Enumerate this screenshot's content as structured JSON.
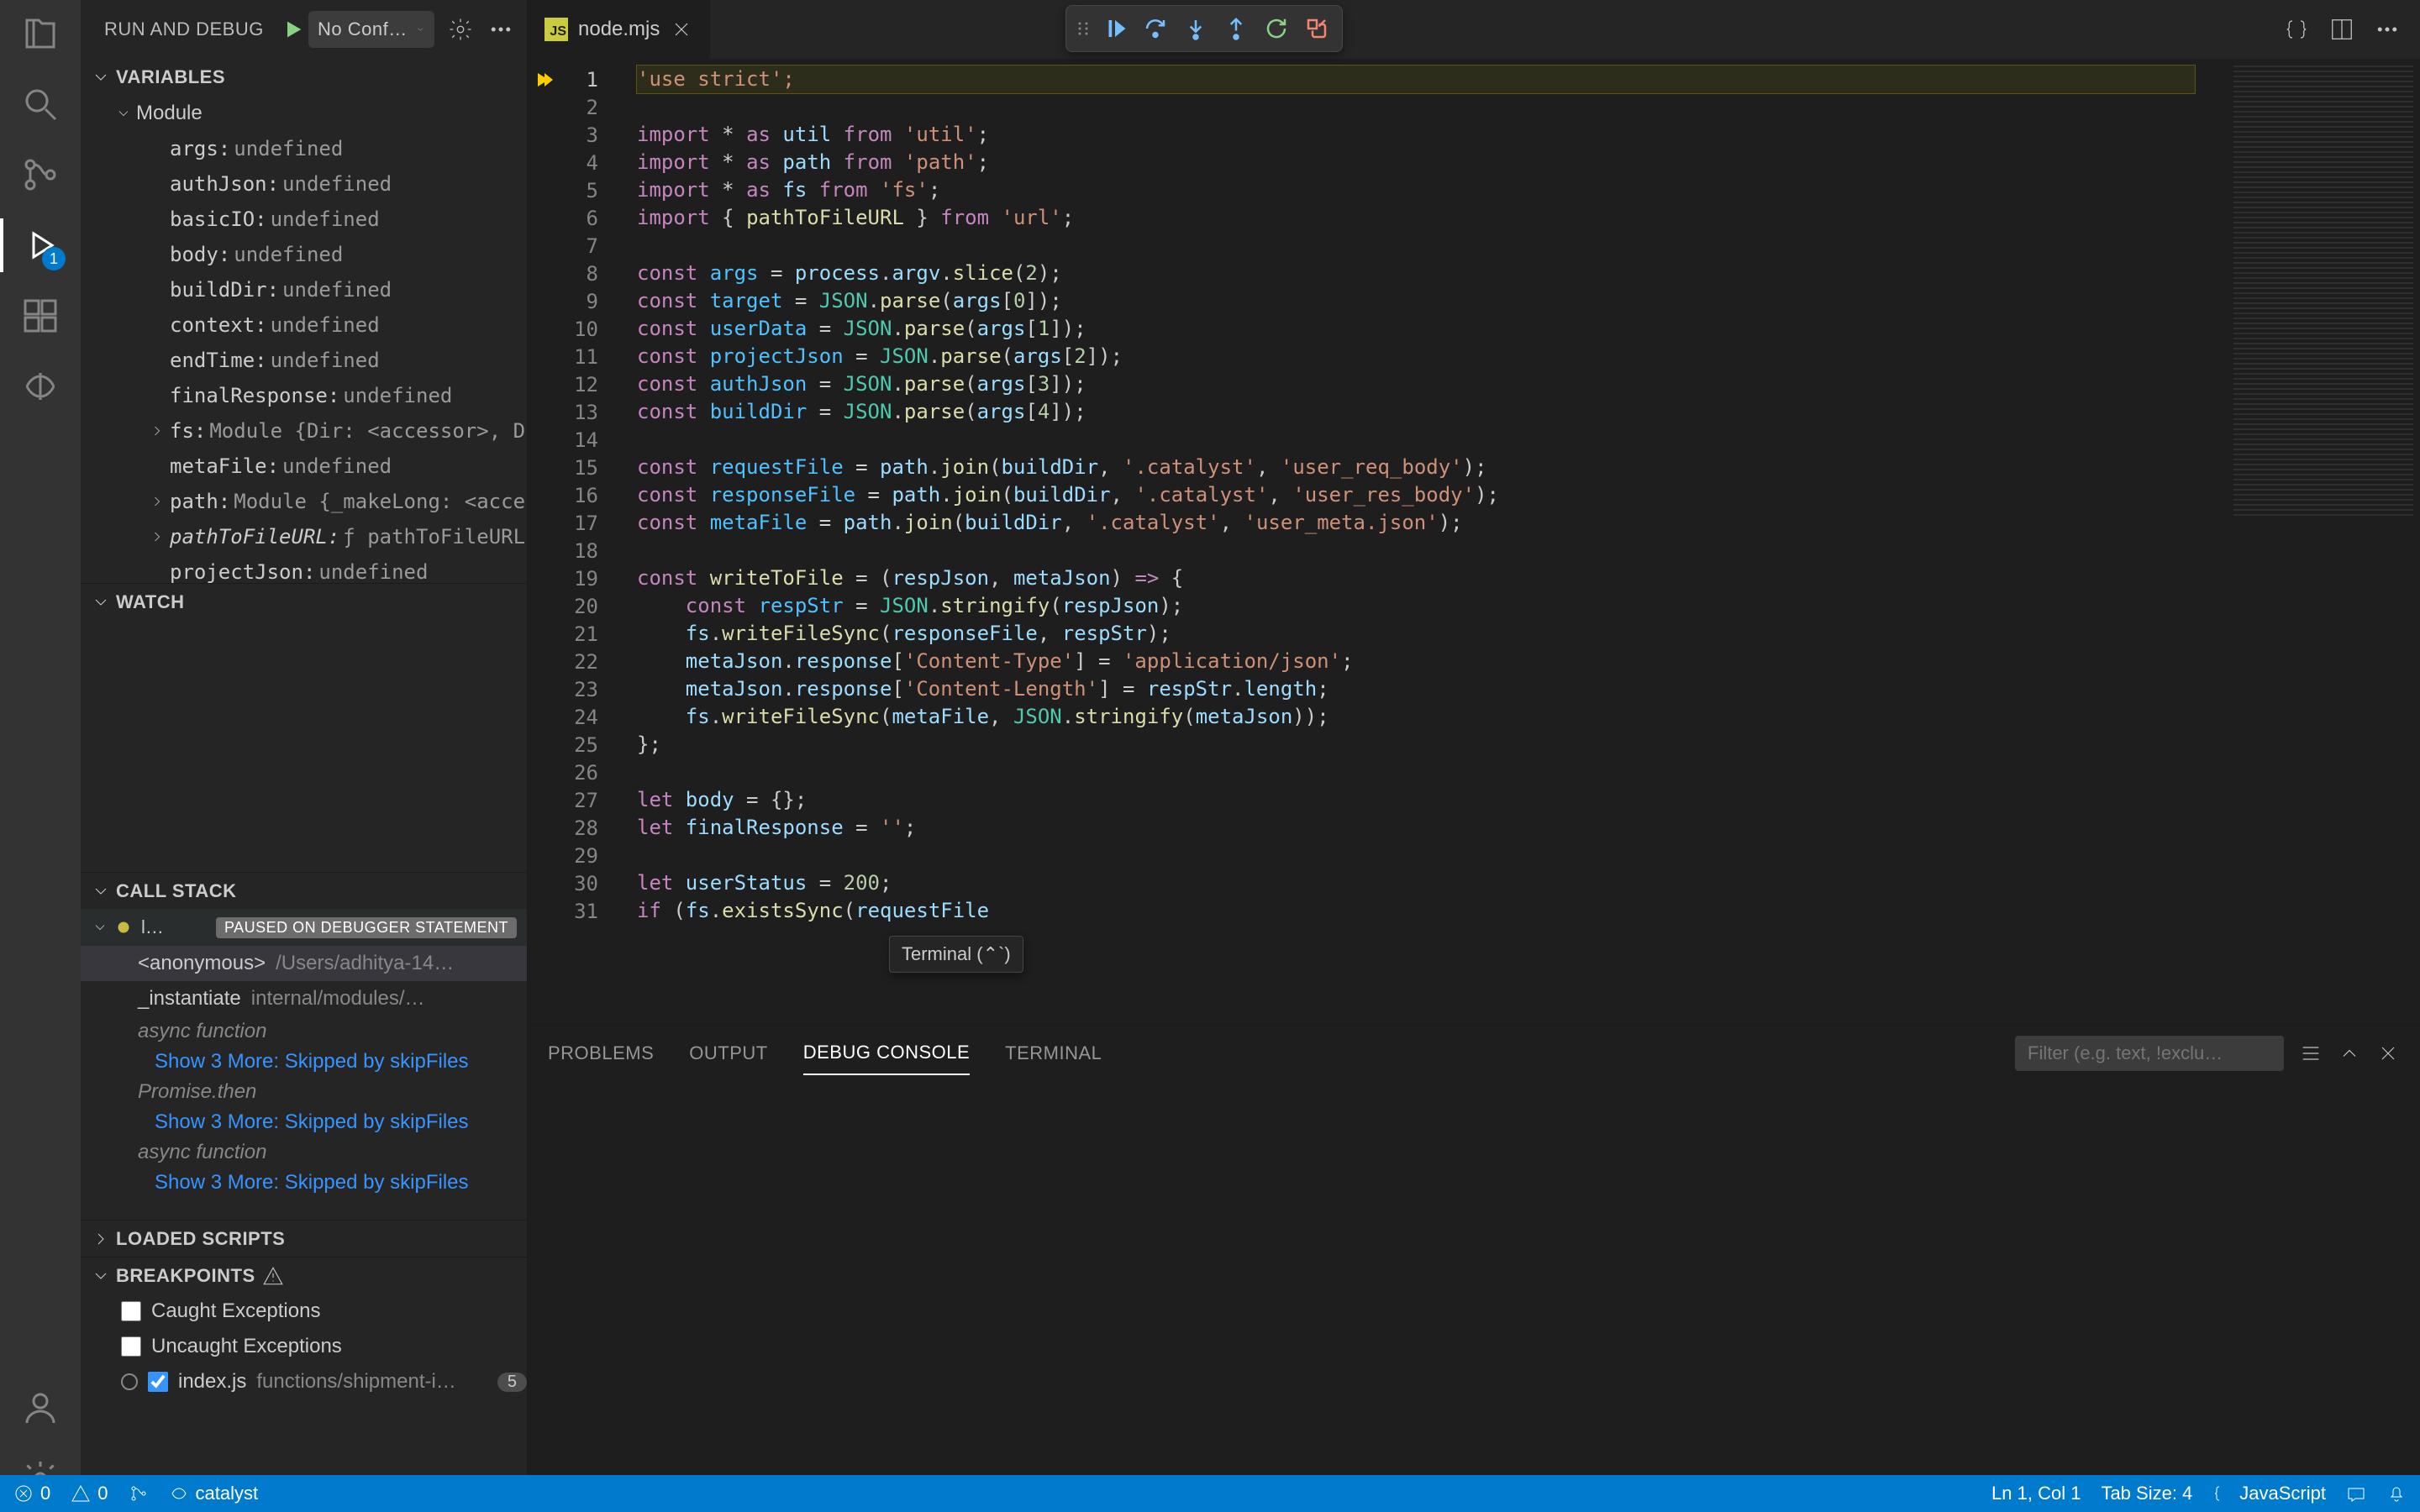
{
  "activity": {
    "debug_badge": "1"
  },
  "sidebar": {
    "title": "RUN AND DEBUG",
    "config_selected": "No Configurations",
    "sections": {
      "variables": "VARIABLES",
      "watch": "WATCH",
      "callstack": "CALL STACK",
      "loaded": "LOADED SCRIPTS",
      "breakpoints": "BREAKPOINTS"
    },
    "vars_scope": "Module",
    "vars": [
      {
        "n": "args:",
        "v": "undefined"
      },
      {
        "n": "authJson:",
        "v": "undefined"
      },
      {
        "n": "basicIO:",
        "v": "undefined"
      },
      {
        "n": "body:",
        "v": "undefined"
      },
      {
        "n": "buildDir:",
        "v": "undefined"
      },
      {
        "n": "context:",
        "v": "undefined"
      },
      {
        "n": "endTime:",
        "v": "undefined"
      },
      {
        "n": "finalResponse:",
        "v": "undefined"
      },
      {
        "n": "fs:",
        "v": "Module {Dir: <accessor>, Dire…",
        "tw": true
      },
      {
        "n": "metaFile:",
        "v": "undefined"
      },
      {
        "n": "path:",
        "v": "Module {_makeLong: <accesso…",
        "tw": true
      },
      {
        "n": "pathToFileURL:",
        "v": "ƒ pathToFileURL(fi…",
        "tw": true,
        "italic": true
      },
      {
        "n": "projectJson:",
        "v": "undefined"
      }
    ],
    "cs_thread_name": "l…",
    "cs_thread_pill": "PAUSED ON DEBUGGER STATEMENT",
    "cs": [
      {
        "fn": "<anonymous>",
        "path": "/Users/adhitya-14…",
        "sel": true
      },
      {
        "fn": "_instantiate",
        "path": "internal/modules/…"
      }
    ],
    "cs_async": "async function",
    "cs_promise": "Promise.then",
    "cs_skip": "Show 3 More: Skipped by skipFiles",
    "bp_caught": "Caught Exceptions",
    "bp_uncaught": "Uncaught Exceptions",
    "bp_file": {
      "name": "index.js",
      "path": "functions/shipment-i…",
      "line": "5"
    }
  },
  "tab": {
    "filename": "node.mjs"
  },
  "tooltip": "Terminal (⌃`)",
  "code_lines": [
    "1",
    "2",
    "3",
    "4",
    "5",
    "6",
    "7",
    "8",
    "9",
    "10",
    "11",
    "12",
    "13",
    "14",
    "15",
    "16",
    "17",
    "18",
    "19",
    "20",
    "21",
    "22",
    "23",
    "24",
    "25",
    "26",
    "27",
    "28",
    "29",
    "30",
    "31"
  ],
  "code": {
    "l1": "'use strict';",
    "l3a": "import",
    "l3b": " * ",
    "l3c": "as",
    "l3d": " util ",
    "l3e": "from",
    "l3f": " 'util'",
    "l4a": "import",
    "l4b": " * ",
    "l4c": "as",
    "l4d": " path ",
    "l4e": "from",
    "l4f": " 'path'",
    "l5a": "import",
    "l5b": " * ",
    "l5c": "as",
    "l5d": " fs ",
    "l5e": "from",
    "l5f": " 'fs'",
    "l6a": "import",
    "l6b": " { ",
    "l6c": "pathToFileURL",
    "l6d": " } ",
    "l6e": "from",
    "l6f": " 'url'",
    "l8a": "const ",
    "l8b": "args",
    "l8c": " = ",
    "l8d": "process",
    "l8e": ".",
    "l8f": "argv",
    "l8g": ".",
    "l8h": "slice",
    "l8i": "(",
    "l8j": "2",
    "l8k": ");",
    "l9a": "const ",
    "l9b": "target",
    "l9c": " = ",
    "l9d": "JSON",
    "l9e": ".",
    "l9f": "parse",
    "l9g": "(",
    "l9h": "args",
    "l9i": "[",
    "l9j": "0",
    "l9k": "]);",
    "l10a": "const ",
    "l10b": "userData",
    "l10j": "1",
    "l11a": "const ",
    "l11b": "projectJson",
    "l11j": "2",
    "l12a": "const ",
    "l12b": "authJson",
    "l12j": "3",
    "l13a": "const ",
    "l13b": "buildDir",
    "l13j": "4",
    "l15a": "const ",
    "l15b": "requestFile",
    "l15c": " = ",
    "l15d": "path",
    "l15e": ".",
    "l15f": "join",
    "l15g": "(",
    "l15h": "buildDir",
    "l15i": ", ",
    "l15j": "'.catalyst'",
    "l15k": ", ",
    "l15l": "'user_req_body'",
    "l15m": ");",
    "l16b": "responseFile",
    "l16l": "'user_res_body'",
    "l17b": "metaFile",
    "l17l": "'user_meta.json'",
    "l19a": "const ",
    "l19b": "writeToFile",
    "l19c": " = (",
    "l19d": "respJson",
    "l19e": ", ",
    "l19f": "metaJson",
    "l19g": ") ",
    "l19h": "=>",
    "l19i": " {",
    "l20a": "    const ",
    "l20b": "respStr",
    "l20c": " = ",
    "l20d": "JSON",
    "l20e": ".",
    "l20f": "stringify",
    "l20g": "(",
    "l20h": "respJson",
    "l20i": ");",
    "l21a": "    fs",
    "l21b": ".",
    "l21c": "writeFileSync",
    "l21d": "(",
    "l21e": "responseFile",
    "l21f": ", ",
    "l21g": "respStr",
    "l21h": ");",
    "l22a": "    metaJson",
    "l22b": ".",
    "l22c": "response",
    "l22d": "[",
    "l22e": "'Content-Type'",
    "l22f": "] = ",
    "l22g": "'application/json'",
    "l22h": ";",
    "l23e": "'Content-Length'",
    "l23g": "respStr",
    "l23h": ".",
    "l23i": "length",
    "l23j": ";",
    "l24a": "    fs",
    "l24c": "writeFileSync",
    "l24e": "metaFile",
    "l24g": "JSON",
    "l24i": "stringify",
    "l24k": "metaJson",
    "l24m": "));",
    "l25": "};",
    "l27a": "let ",
    "l27b": "body",
    "l27c": " = {};",
    "l28a": "let ",
    "l28b": "finalResponse",
    "l28c": " = ",
    "l28d": "''",
    "l28e": ";",
    "l30a": "let ",
    "l30b": "userStatus",
    "l30c": " = ",
    "l30d": "200",
    "l30e": ";",
    "l31a": "if ",
    "l31b": "(",
    "l31c": "fs",
    "l31d": ".",
    "l31e": "existsSync",
    "l31f": "(",
    "l31g": "requestFile"
  },
  "panel": {
    "tabs": [
      "PROBLEMS",
      "OUTPUT",
      "DEBUG CONSOLE",
      "TERMINAL"
    ],
    "filter_placeholder": "Filter (e.g. text, !exclu…"
  },
  "status": {
    "errors": "0",
    "warnings": "0",
    "branch": "catalyst",
    "ln": "Ln 1, Col 1",
    "tab": "Tab Size: 4",
    "lang": "JavaScript"
  }
}
